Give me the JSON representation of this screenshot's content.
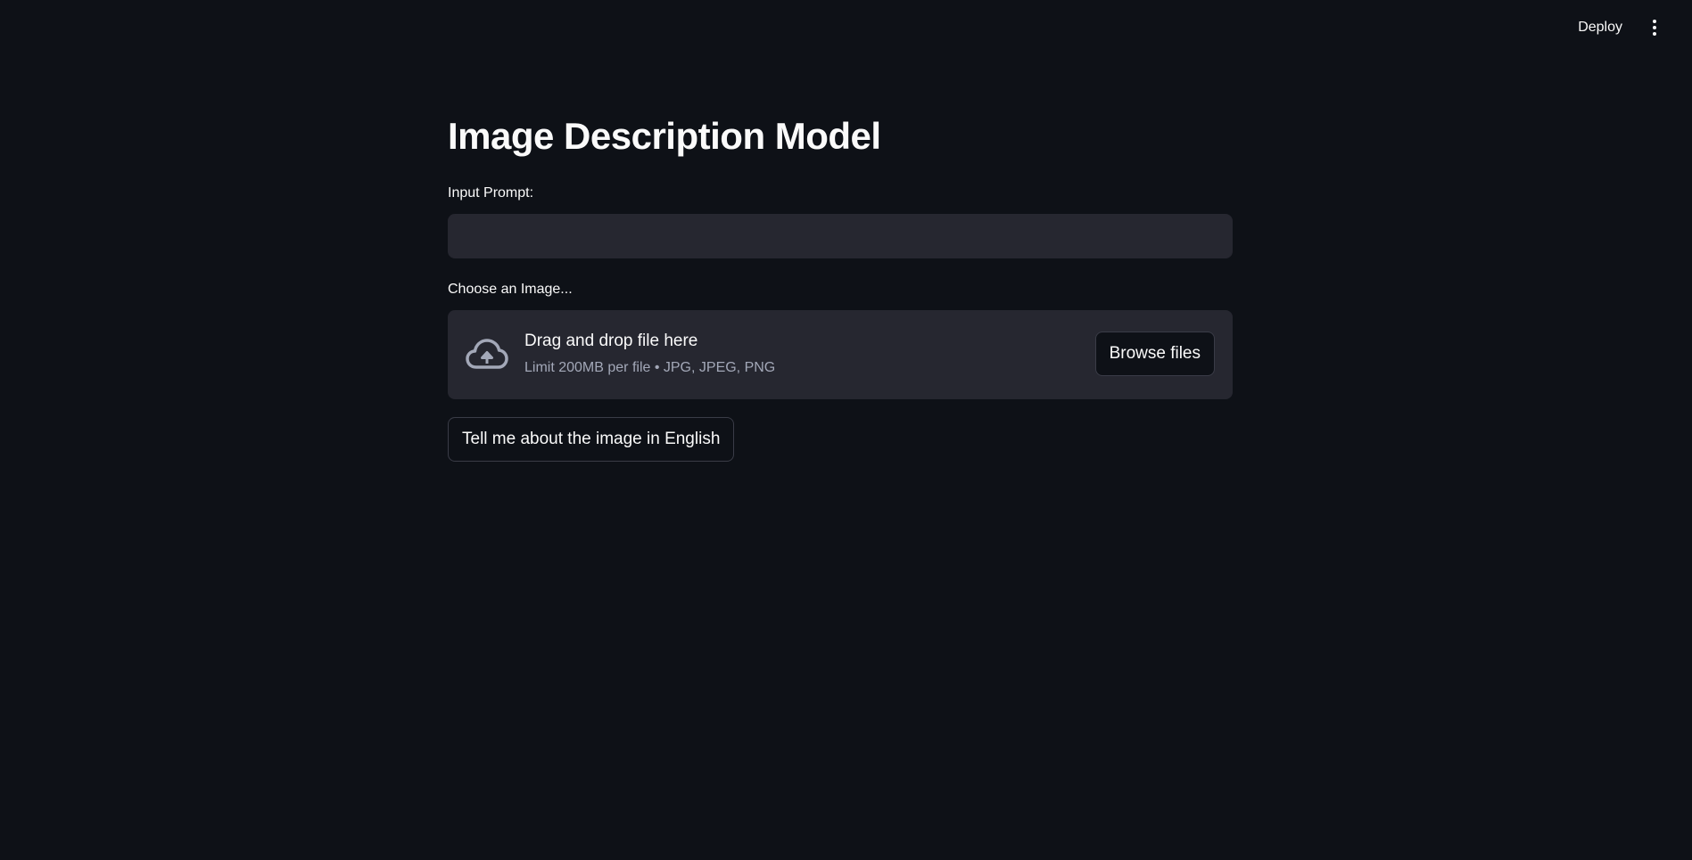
{
  "header": {
    "deploy_label": "Deploy",
    "menu_icon": "vertical-ellipsis-icon"
  },
  "main": {
    "title": "Image Description Model",
    "prompt_field": {
      "label": "Input Prompt:",
      "value": "",
      "placeholder": ""
    },
    "uploader": {
      "label": "Choose an Image...",
      "icon": "cloud-upload-icon",
      "instructions": "Drag and drop file here",
      "limits": "Limit 200MB per file • JPG, JPEG, PNG",
      "browse_label": "Browse files"
    },
    "submit_label": "Tell me about the image in English"
  },
  "colors": {
    "background": "#0e1117",
    "surface": "#262730",
    "text": "#fafafa",
    "muted_text": "#a3a8b8",
    "border": "#3a3c47"
  }
}
